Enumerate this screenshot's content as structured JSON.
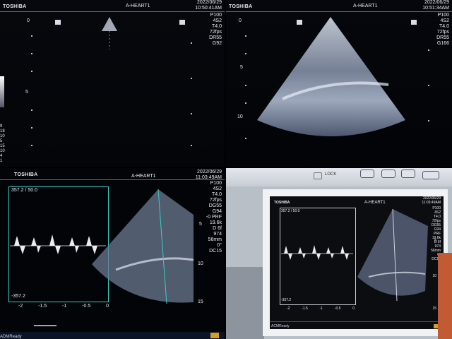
{
  "panel1": {
    "brand": "TOSHIBA",
    "title": "A-HEART1",
    "date": "2022/06/29",
    "time": "10:50:41AM",
    "params": [
      "P100",
      "4S2",
      "T4.0",
      "72fps",
      "DR55",
      "G92"
    ],
    "depth_marks": [
      "0",
      "5"
    ],
    "left_marks": [
      "9",
      "18",
      "10",
      "5",
      "15",
      "10",
      "4",
      "1"
    ]
  },
  "panel2": {
    "brand": "TOSHIBA",
    "title": "A-HEART1",
    "date": "2022/06/29",
    "time": "10:51:34AM",
    "params": [
      "P100",
      "4S2",
      "T4.0",
      "72fps",
      "DR55",
      "G166"
    ],
    "depth_marks": [
      "0",
      "5",
      "10"
    ]
  },
  "panel3": {
    "brand": "TOSHIBA",
    "title": "A-HEART1",
    "date": "2022/06/29",
    "time": "11:03:49AM",
    "params": [
      "P100",
      "4S2",
      "T4.0",
      "72fps",
      "DG55",
      "G94",
      "-0 PRF",
      "19.6k",
      "D 6f",
      "974",
      "56mm",
      "0°",
      "DC15"
    ],
    "velocity_top": "357.2 / 50.0",
    "velocity_bottom": "-357.2",
    "time_axis": [
      "-2",
      "-1.5",
      "-1",
      "-0.5",
      "0"
    ],
    "depth_marks": [
      "5",
      "10",
      "15"
    ],
    "status": "ADMReady"
  },
  "panel4": {
    "brand": "TOSHIBA",
    "title": "A-HEART1",
    "date": "2022/06/29",
    "time": "11:03:49AM",
    "params": [
      "P100",
      "4S2",
      "T4.0",
      "72fps",
      "DG55",
      "G94",
      "PRF",
      "19.6k",
      "D 6f",
      "974",
      "56mm",
      "0°",
      "DC15"
    ],
    "velocity_top": "357.2 / 50.0",
    "velocity_bottom": "-357.2",
    "time_axis": [
      "-2",
      "-1.5",
      "-1",
      "-0.5",
      "0"
    ],
    "depth_marks": [
      "5",
      "10",
      "15"
    ],
    "status": "ACMReady",
    "lock": "LOCK"
  }
}
